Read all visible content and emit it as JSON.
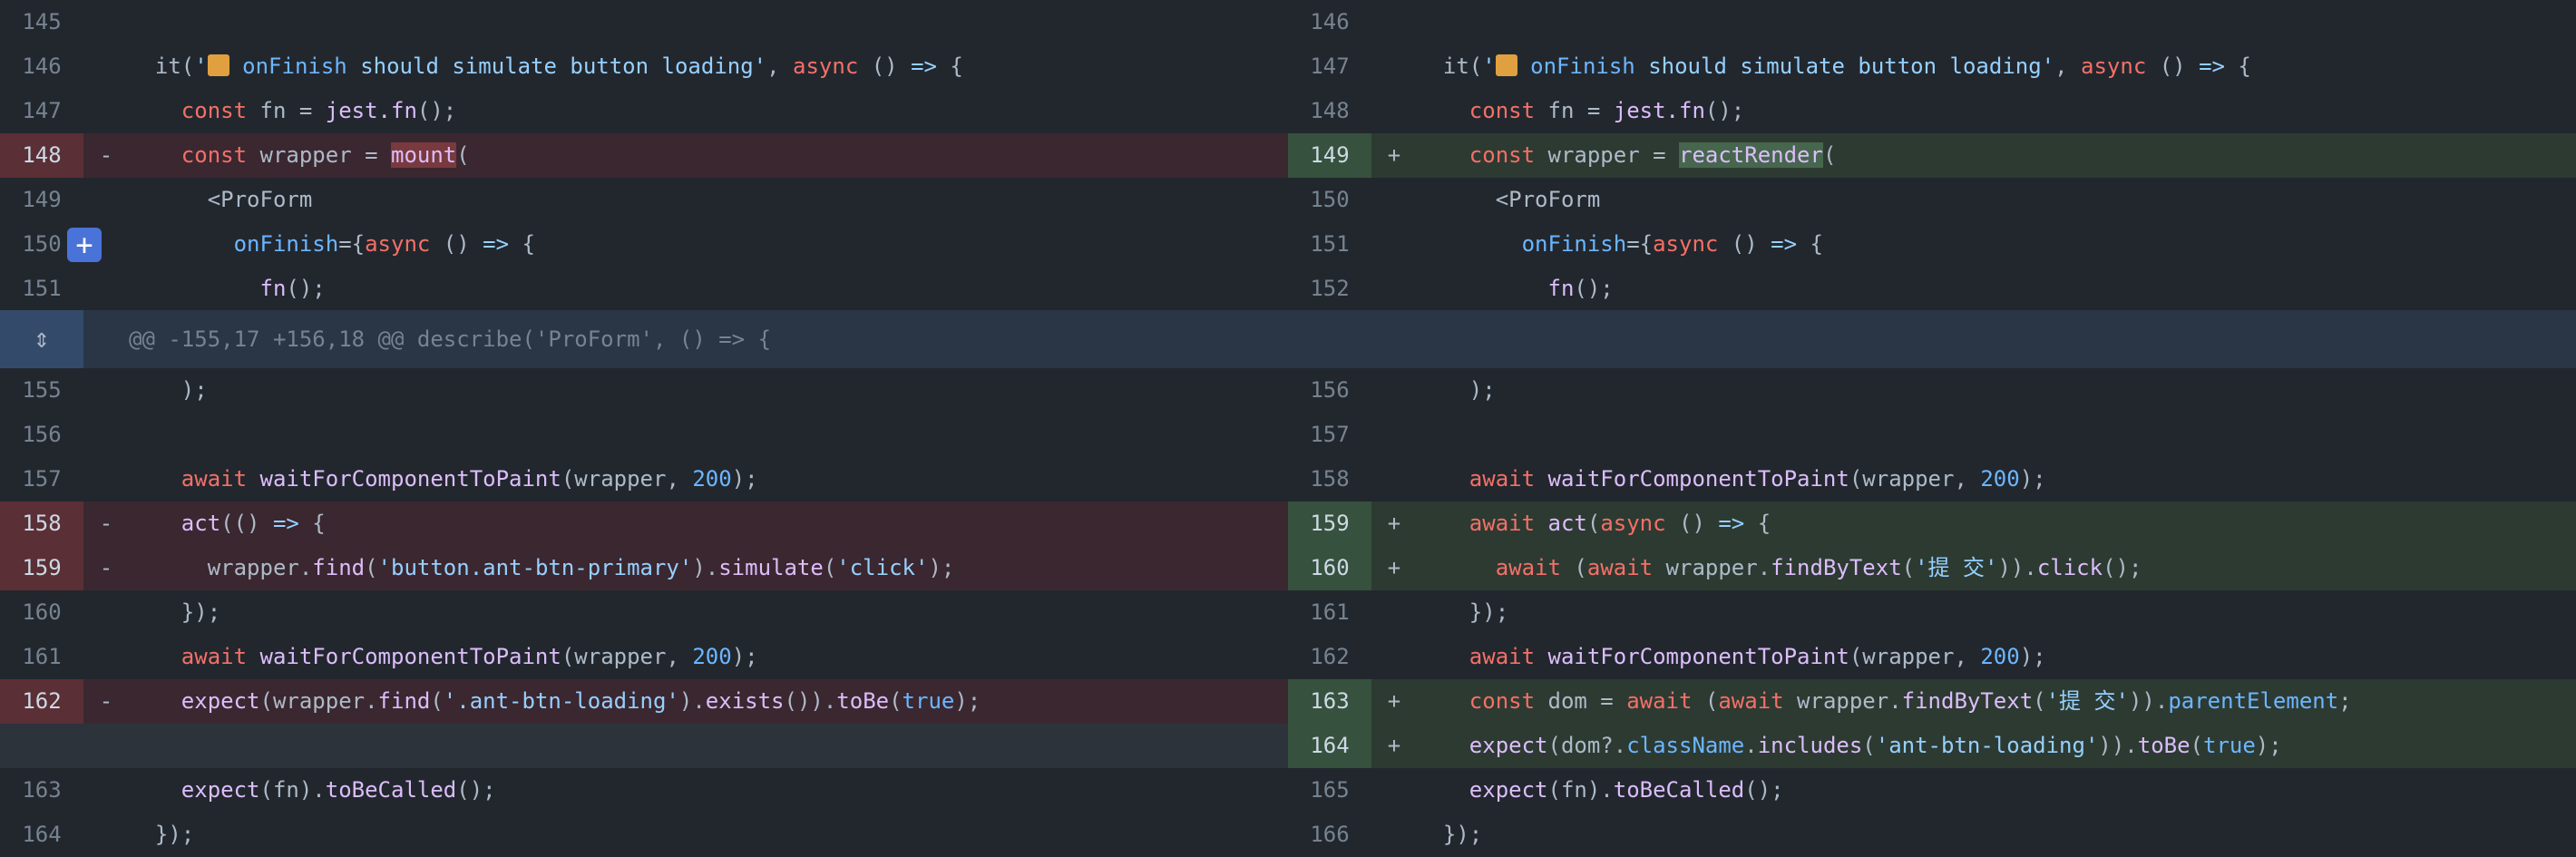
{
  "left": {
    "top_rows": [
      {
        "n": "145",
        "m": "",
        "t": "",
        "type": "ctx"
      },
      {
        "n": "146",
        "m": "",
        "t": "  it('📦 onFinish should simulate button loading', async () => {",
        "type": "ctx"
      },
      {
        "n": "147",
        "m": "",
        "t": "    const fn = jest.fn();",
        "type": "ctx"
      },
      {
        "n": "148",
        "m": "-",
        "t": "    const wrapper = mount(",
        "type": "del"
      },
      {
        "n": "149",
        "m": "",
        "t": "      <ProForm",
        "type": "ctx"
      },
      {
        "n": "150",
        "m": "",
        "t": "        onFinish={async () => {",
        "type": "ctx"
      },
      {
        "n": "151",
        "m": "",
        "t": "          fn();",
        "type": "ctx"
      }
    ],
    "bottom_rows": [
      {
        "n": "155",
        "m": "",
        "t": "    );",
        "type": "ctx"
      },
      {
        "n": "156",
        "m": "",
        "t": "",
        "type": "ctx"
      },
      {
        "n": "157",
        "m": "",
        "t": "    await waitForComponentToPaint(wrapper, 200);",
        "type": "ctx"
      },
      {
        "n": "158",
        "m": "-",
        "t": "    act(() => {",
        "type": "del"
      },
      {
        "n": "159",
        "m": "-",
        "t": "      wrapper.find('button.ant-btn-primary').simulate('click');",
        "type": "del"
      },
      {
        "n": "160",
        "m": "",
        "t": "    });",
        "type": "ctx"
      },
      {
        "n": "161",
        "m": "",
        "t": "    await waitForComponentToPaint(wrapper, 200);",
        "type": "ctx"
      },
      {
        "n": "162",
        "m": "-",
        "t": "    expect(wrapper.find('.ant-btn-loading').exists()).toBe(true);",
        "type": "del"
      },
      {
        "n": "",
        "m": "",
        "t": "",
        "type": "empty"
      },
      {
        "n": "163",
        "m": "",
        "t": "    expect(fn).toBeCalled();",
        "type": "ctx"
      },
      {
        "n": "164",
        "m": "",
        "t": "  });",
        "type": "ctx"
      }
    ]
  },
  "right": {
    "top_rows": [
      {
        "n": "146",
        "m": "",
        "t": "",
        "type": "ctx"
      },
      {
        "n": "147",
        "m": "",
        "t": "  it('📦 onFinish should simulate button loading', async () => {",
        "type": "ctx"
      },
      {
        "n": "148",
        "m": "",
        "t": "    const fn = jest.fn();",
        "type": "ctx"
      },
      {
        "n": "149",
        "m": "+",
        "t": "    const wrapper = reactRender(",
        "type": "add"
      },
      {
        "n": "150",
        "m": "",
        "t": "      <ProForm",
        "type": "ctx"
      },
      {
        "n": "151",
        "m": "",
        "t": "        onFinish={async () => {",
        "type": "ctx"
      },
      {
        "n": "152",
        "m": "",
        "t": "          fn();",
        "type": "ctx"
      }
    ],
    "bottom_rows": [
      {
        "n": "156",
        "m": "",
        "t": "    );",
        "type": "ctx"
      },
      {
        "n": "157",
        "m": "",
        "t": "",
        "type": "ctx"
      },
      {
        "n": "158",
        "m": "",
        "t": "    await waitForComponentToPaint(wrapper, 200);",
        "type": "ctx"
      },
      {
        "n": "159",
        "m": "+",
        "t": "    await act(async () => {",
        "type": "add"
      },
      {
        "n": "160",
        "m": "+",
        "t": "      await (await wrapper.findByText('提 交')).click();",
        "type": "add"
      },
      {
        "n": "161",
        "m": "",
        "t": "    });",
        "type": "ctx"
      },
      {
        "n": "162",
        "m": "",
        "t": "    await waitForComponentToPaint(wrapper, 200);",
        "type": "ctx"
      },
      {
        "n": "163",
        "m": "+",
        "t": "    const dom = await (await wrapper.findByText('提 交')).parentElement;",
        "type": "add"
      },
      {
        "n": "164",
        "m": "+",
        "t": "    expect(dom?.className.includes('ant-btn-loading')).toBe(true);",
        "type": "add"
      },
      {
        "n": "165",
        "m": "",
        "t": "    expect(fn).toBeCalled();",
        "type": "ctx"
      },
      {
        "n": "166",
        "m": "",
        "t": "  });",
        "type": "ctx"
      }
    ]
  },
  "hunk_header": "@@ -155,17 +156,18 @@ describe('ProForm', () => {",
  "icons": {
    "expand": "expand-icon",
    "comment": "add-comment-icon",
    "package": "package-emoji"
  }
}
